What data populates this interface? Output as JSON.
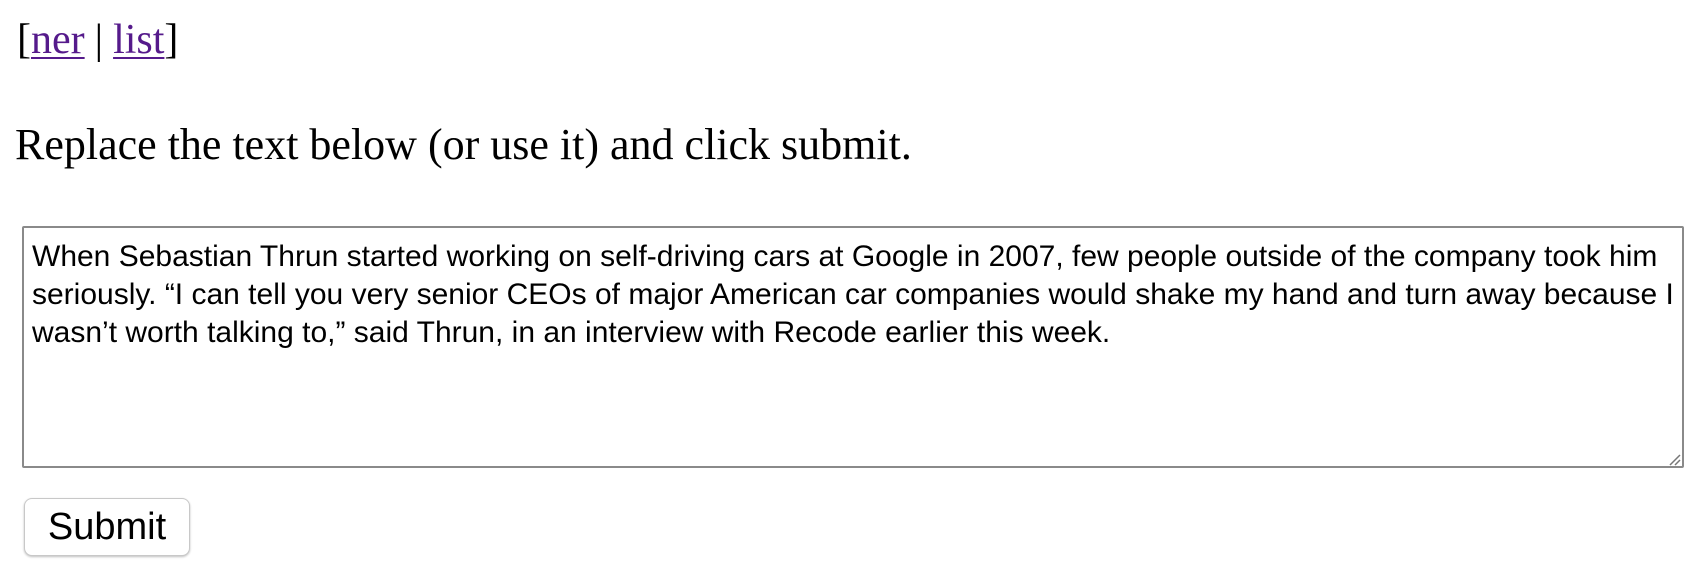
{
  "nav": {
    "open_bracket": "[",
    "ner_link": "ner",
    "separator": "|",
    "list_link": "list",
    "close_bracket": "]"
  },
  "instruction": "Replace the text below (or use it) and click submit.",
  "input": {
    "value": "When Sebastian Thrun started working on self-driving cars at Google in 2007, few people outside of the company took him seriously. “I can tell you very senior CEOs of major American car companies would shake my hand and turn away because I wasn’t worth talking to,” said Thrun, in an interview with Recode earlier this week."
  },
  "submit_label": "Submit",
  "colors": {
    "visited_link": "#551a8b",
    "textarea_border": "#8a8a8a"
  },
  "icons": {
    "resize_handle": "resize-grip-icon"
  }
}
